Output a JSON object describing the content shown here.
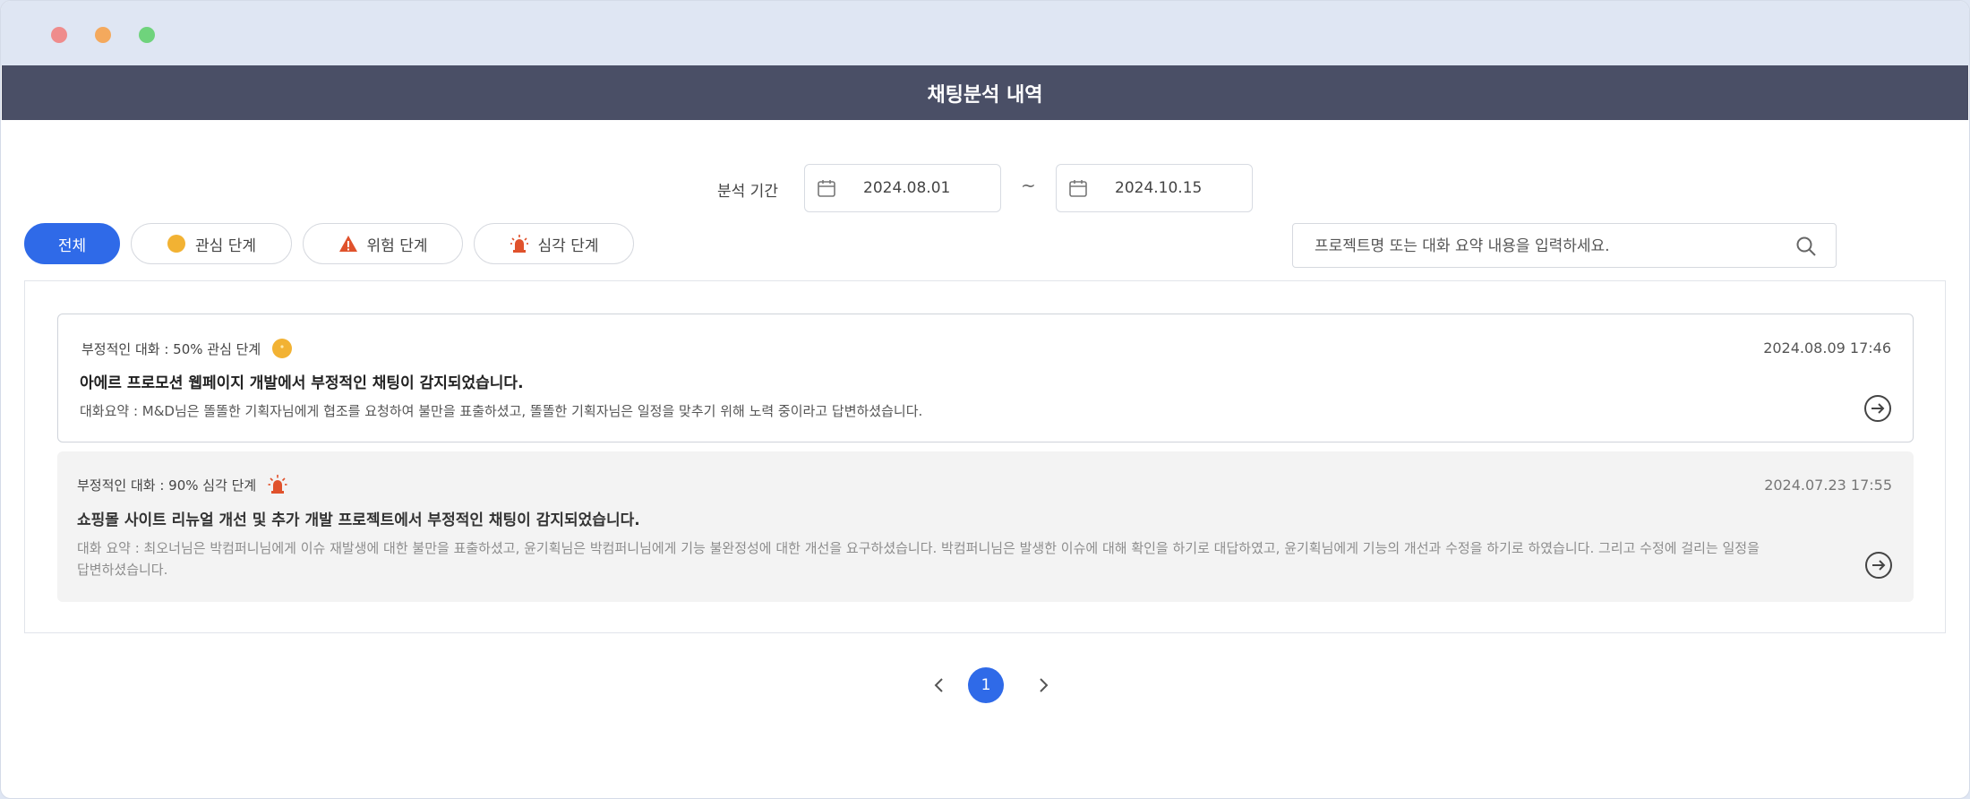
{
  "window": {
    "title": "채팅분석 내역"
  },
  "period": {
    "label": "분석 기간",
    "start": "2024.08.01",
    "separator": "~",
    "end": "2024.10.15"
  },
  "filters": [
    {
      "label": "전체",
      "active": true
    },
    {
      "label": "관심 단계",
      "icon": "yellow-circle-icon"
    },
    {
      "label": "위험 단계",
      "icon": "warning-triangle-icon"
    },
    {
      "label": "심각 단계",
      "icon": "siren-icon"
    }
  ],
  "search": {
    "placeholder": "프로젝트명 또는 대화 요약 내용을 입력하세요."
  },
  "items": [
    {
      "level": "부정적인 대화 : 50% 관심 단계",
      "icon": "yellow-circle-icon",
      "date": "2024.08.09 17:46",
      "title": "아에르 프로모션 웹페이지 개발에서 부정적인 채팅이 감지되었습니다.",
      "summary": "대화요약 : M&D님은 똘똘한 기획자님에게 협조를 요청하여 불만을 표출하셨고, 똘똘한 기획자님은 일정을 맞추기 위해 노력 중이라고 답변하셨습니다."
    },
    {
      "level": "부정적인 대화 : 90% 심각 단계",
      "icon": "siren-icon",
      "date": "2024.07.23 17:55",
      "title": "쇼핑몰 사이트 리뉴얼 개선 및 추가 개발 프로젝트에서 부정적인 채팅이 감지되었습니다.",
      "summary": "대화 요약 : 최오너님은 박컴퍼니님에게 이슈 재발생에 대한 불만을 표출하셨고, 윤기획님은 박컴퍼니님에게 기능 불완정성에 대한 개선을 요구하셨습니다.  박컴퍼니님은 발생한 이슈에 대해 확인을 하기로 대답하였고, 윤기획님에게 기능의 개선과 수정을 하기로 하였습니다. 그리고 수정에 걸리는 일정을 답변하셨습니다."
    }
  ],
  "pagination": {
    "current": "1"
  },
  "colors": {
    "accent": "#2f6ae8",
    "header": "#4a4f66",
    "caution": "#f2b233",
    "danger": "#e0522c"
  }
}
